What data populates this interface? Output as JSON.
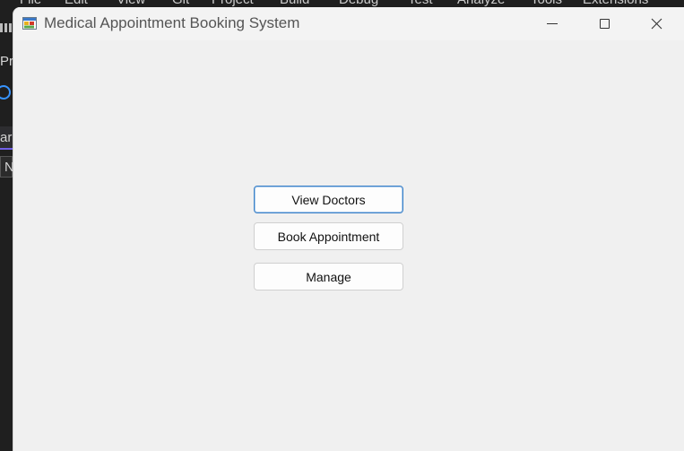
{
  "window": {
    "title": "Medical Appointment Booking System"
  },
  "main": {
    "buttons": [
      {
        "label": "View Doctors"
      },
      {
        "label": "Book Appointment"
      },
      {
        "label": "Manage"
      }
    ]
  },
  "background_ide": {
    "menu": [
      "File",
      "Edit",
      "View",
      "Git",
      "Project",
      "Build",
      "Debug",
      "Test",
      "Analyze",
      "Tools",
      "Extensions"
    ],
    "left_fragments": [
      "Pr",
      "ar",
      "N"
    ]
  },
  "icons": {
    "app": "winforms-app-icon",
    "minimize": "minimize-icon",
    "maximize": "maximize-icon",
    "close": "close-icon"
  },
  "colors": {
    "window_bg": "#f0f0f0",
    "focus_border": "#3c82c8",
    "ide_bg": "#1f1f1f"
  }
}
